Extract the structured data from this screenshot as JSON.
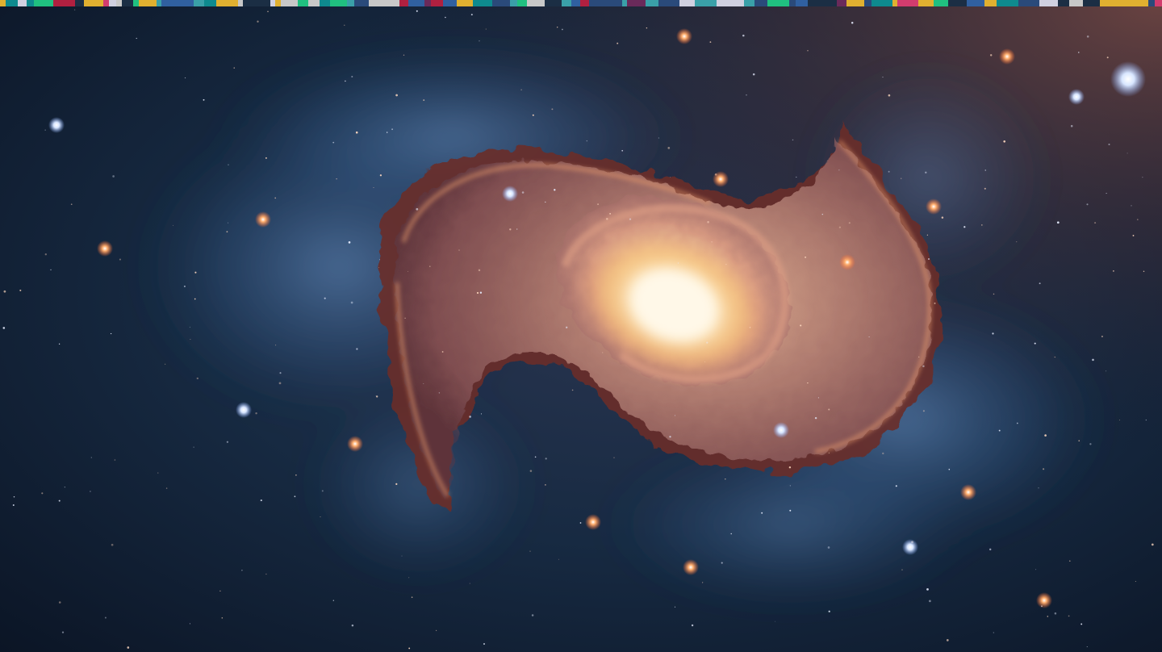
{
  "image": {
    "kind": "spiral-galaxy-artwork",
    "colors": {
      "space_dark": "#0b1322",
      "space_blue": "#1b3552",
      "nebula_blue": "#6f9ed6",
      "arm_rose": "#b98679",
      "rim_orange": "#f0a070",
      "dust_dark": "#4a1e1c",
      "core_white": "#fff4d8",
      "core_gold": "#f6c27a",
      "corner_glow": "#5a3a38"
    },
    "top_strip": {
      "colors": [
        "#1b2e44",
        "#3aa0a8",
        "#d23c6e",
        "#2a4a7a",
        "#c8c8c8",
        "#0e8a8e",
        "#6a2a5a",
        "#e0b030",
        "#3060a0",
        "#b02040",
        "#20c080",
        "#d0d0e0"
      ]
    }
  }
}
